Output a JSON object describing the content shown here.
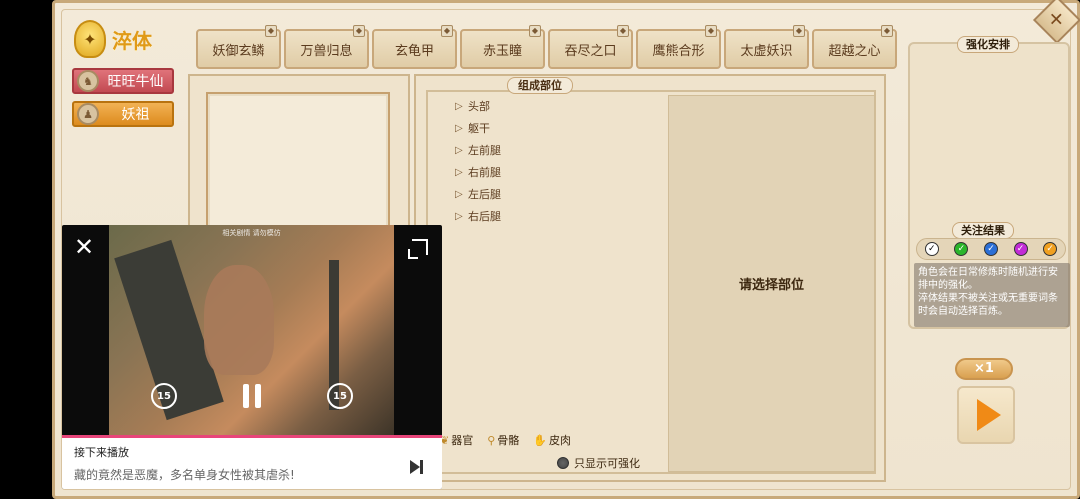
{
  "title": "淬体",
  "title_icon": "ornate-gold-emblem",
  "characters": [
    {
      "name": "旺旺牛仙"
    },
    {
      "name": "妖祖"
    }
  ],
  "tabs": [
    "妖御玄鳞",
    "万兽归息",
    "玄龟甲",
    "赤玉瞳",
    "吞尽之口",
    "鹰熊合形",
    "太虚妖识",
    "超越之心"
  ],
  "composition": {
    "label": "组成部位",
    "parts": [
      "头部",
      "躯干",
      "左前腿",
      "右前腿",
      "左后腿",
      "右后腿"
    ],
    "preview_text": "请选择部位"
  },
  "filters": {
    "organ": "器官",
    "bone": "骨骼",
    "skin": "皮肉",
    "only_enhanceable": "只显示可强化"
  },
  "right": {
    "arrange_label": "强化安排",
    "focus_label": "关注结果",
    "focus_colors": [
      "#ffffff",
      "#2bb52b",
      "#2b6fd6",
      "#c22bd6",
      "#f0a020"
    ],
    "description": "角色会在日常修炼时随机进行安排中的强化。\n淬体结果不被关注或无重要词条时会自动选择百炼。",
    "multiplier": "×1"
  },
  "video": {
    "overlay_text": "相关剧情  请勿模仿",
    "skip_back": "15",
    "skip_forward": "15",
    "next_title": "接下来播放",
    "next_desc": "藏的竟然是恶魔，多名单身女性被其虐杀!"
  },
  "colors": {
    "title_gold": "#e09a18",
    "char_red": "#c24a52",
    "char_orange": "#dd8b1e",
    "play_orange": "#f08a16",
    "progress_pink": "#e8457a"
  }
}
